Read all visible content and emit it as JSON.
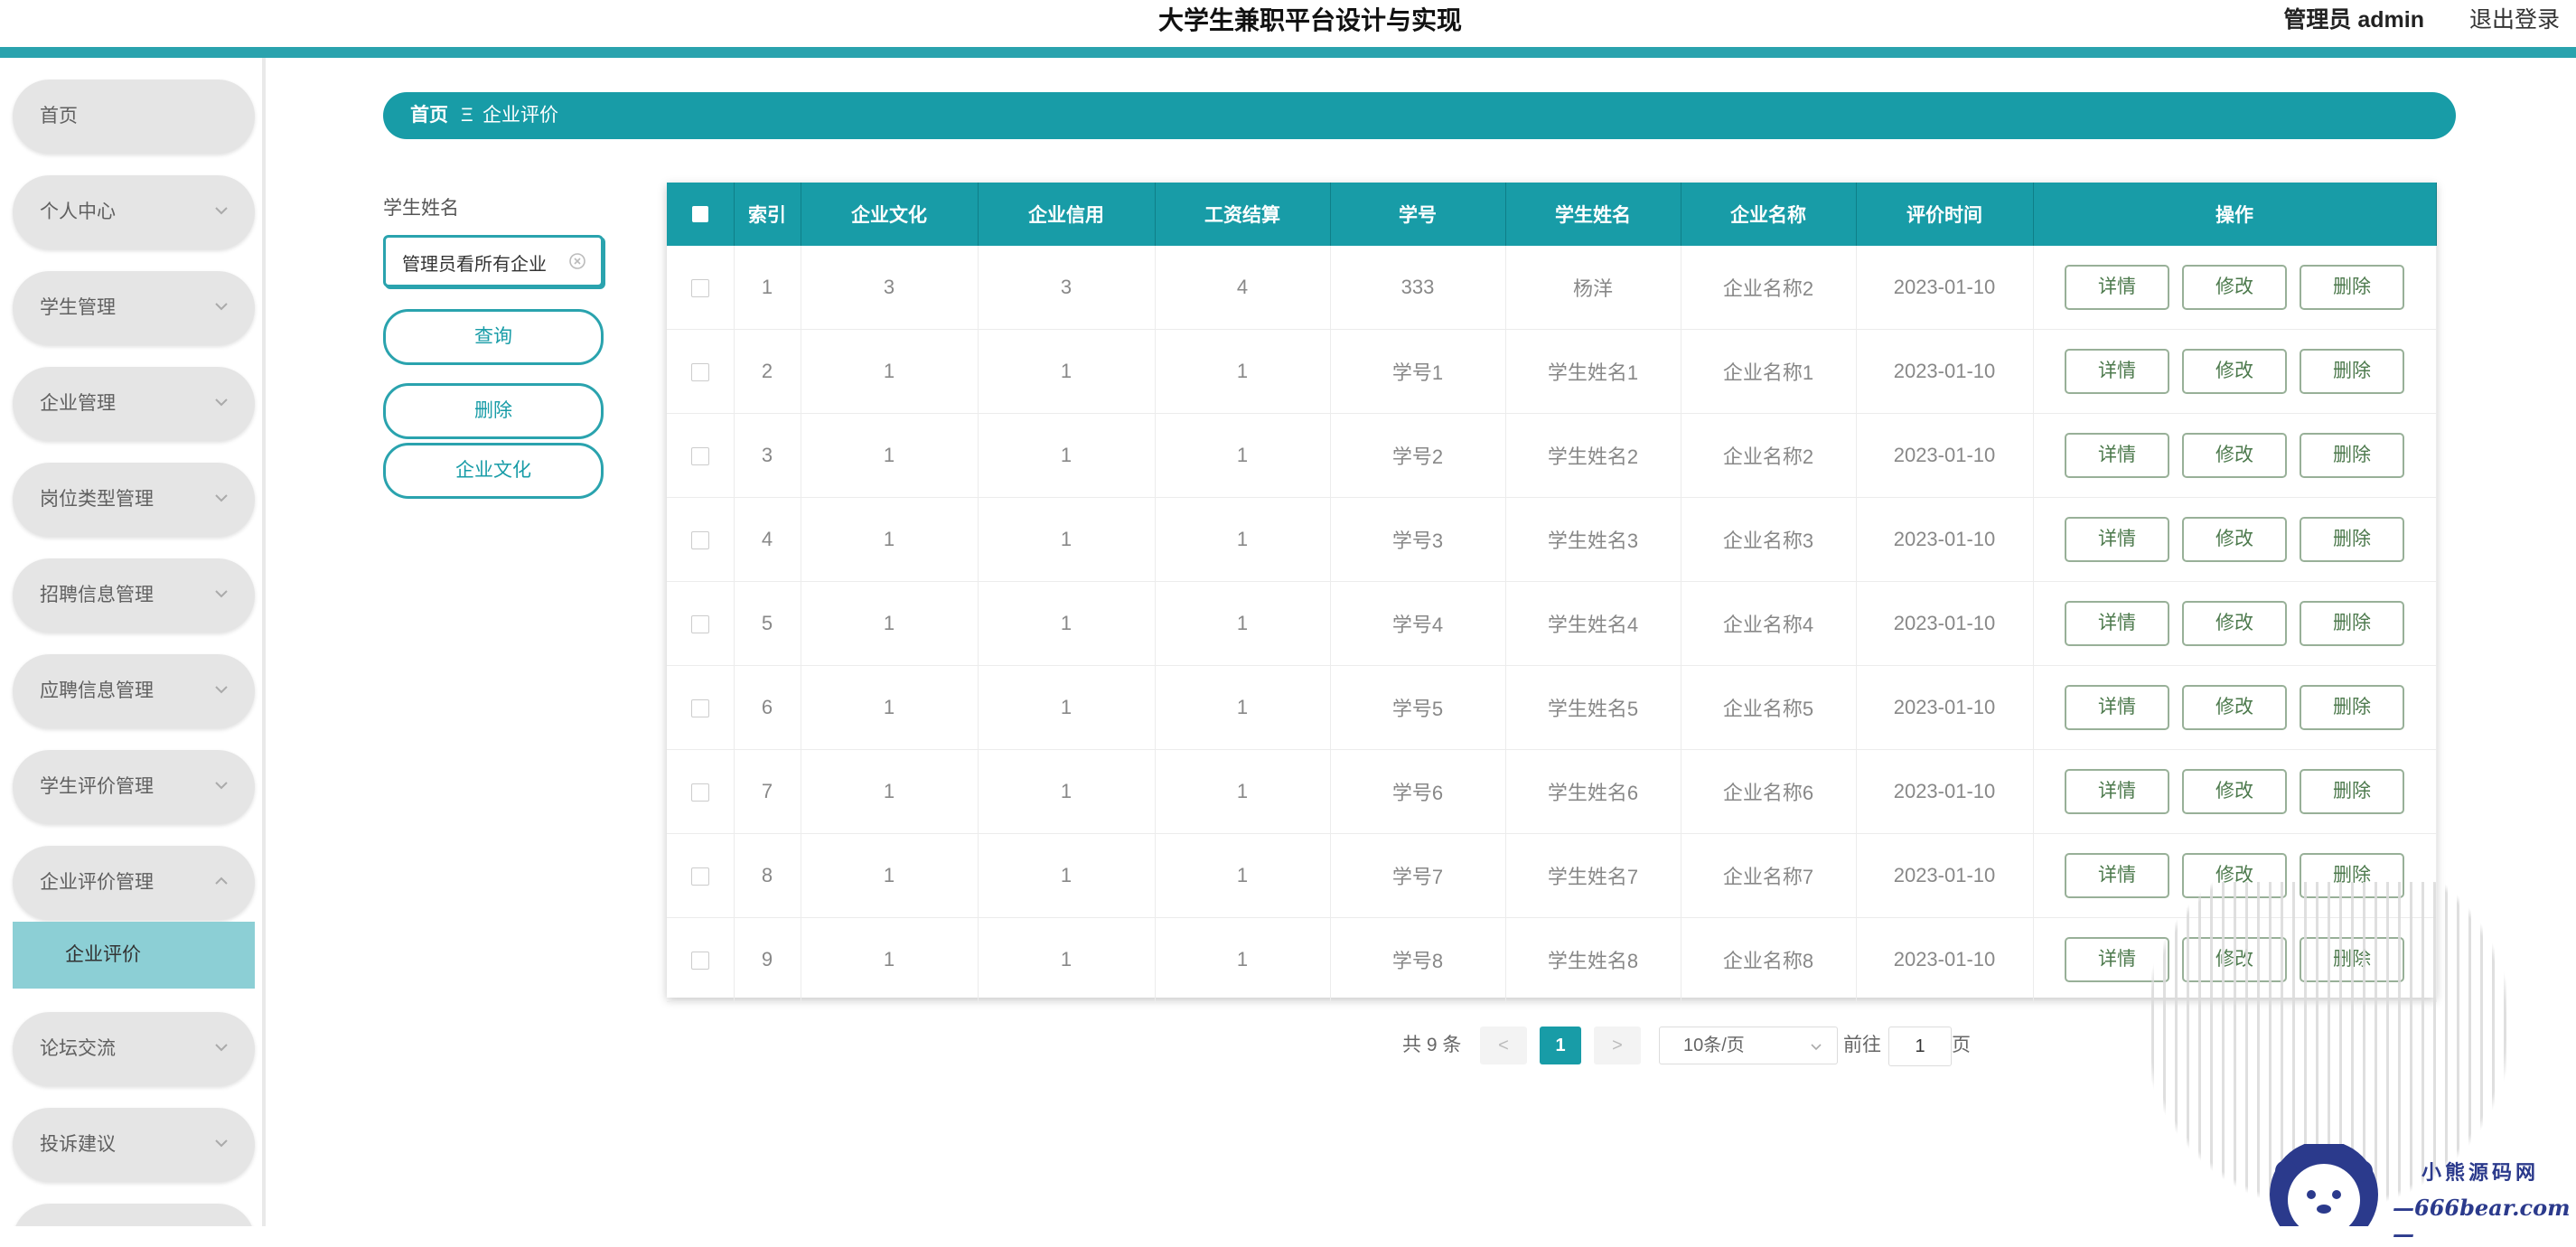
{
  "header": {
    "title": "大学生兼职平台设计与实现",
    "user": "管理员 admin",
    "logout": "退出登录"
  },
  "sidebar": {
    "items": [
      {
        "label": "首页",
        "chevron": "none"
      },
      {
        "label": "个人中心",
        "chevron": "down"
      },
      {
        "label": "学生管理",
        "chevron": "down"
      },
      {
        "label": "企业管理",
        "chevron": "down"
      },
      {
        "label": "岗位类型管理",
        "chevron": "down"
      },
      {
        "label": "招聘信息管理",
        "chevron": "down"
      },
      {
        "label": "应聘信息管理",
        "chevron": "down"
      },
      {
        "label": "学生评价管理",
        "chevron": "down"
      },
      {
        "label": "企业评价管理",
        "chevron": "up"
      },
      {
        "label": "论坛交流",
        "chevron": "down"
      },
      {
        "label": "投诉建议",
        "chevron": "down"
      }
    ],
    "sub_item": "企业评价"
  },
  "breadcrumb": {
    "home": "首页",
    "separator": "Ξ",
    "current": "企业评价"
  },
  "search": {
    "label": "学生姓名",
    "value": "管理员看所有企业",
    "query_button": "查询",
    "delete_button": "删除",
    "culture_button": "企业文化"
  },
  "table": {
    "headers": [
      "索引",
      "企业文化",
      "企业信用",
      "工资结算",
      "学号",
      "学生姓名",
      "企业名称",
      "评价时间",
      "操作"
    ],
    "rows": [
      [
        "1",
        "3",
        "3",
        "4",
        "333",
        "杨洋",
        "企业名称2",
        "2023-01-10"
      ],
      [
        "2",
        "1",
        "1",
        "1",
        "学号1",
        "学生姓名1",
        "企业名称1",
        "2023-01-10"
      ],
      [
        "3",
        "1",
        "1",
        "1",
        "学号2",
        "学生姓名2",
        "企业名称2",
        "2023-01-10"
      ],
      [
        "4",
        "1",
        "1",
        "1",
        "学号3",
        "学生姓名3",
        "企业名称3",
        "2023-01-10"
      ],
      [
        "5",
        "1",
        "1",
        "1",
        "学号4",
        "学生姓名4",
        "企业名称4",
        "2023-01-10"
      ],
      [
        "6",
        "1",
        "1",
        "1",
        "学号5",
        "学生姓名5",
        "企业名称5",
        "2023-01-10"
      ],
      [
        "7",
        "1",
        "1",
        "1",
        "学号6",
        "学生姓名6",
        "企业名称6",
        "2023-01-10"
      ],
      [
        "8",
        "1",
        "1",
        "1",
        "学号7",
        "学生姓名7",
        "企业名称7",
        "2023-01-10"
      ],
      [
        "9",
        "1",
        "1",
        "1",
        "学号8",
        "学生姓名8",
        "企业名称8",
        "2023-01-10"
      ]
    ],
    "actions": [
      "详情",
      "修改",
      "删除"
    ]
  },
  "pagination": {
    "total": "共 9 条",
    "prev": "<",
    "current_page": "1",
    "next": ">",
    "page_size": "10条/页",
    "goto_label": "前往",
    "goto_value": "1",
    "page_suffix": "页"
  },
  "watermark": {
    "name": "小熊源码网",
    "url": "—666bear.com—"
  },
  "colors": {
    "primary": "#189ca7",
    "stripe": "#2aa3ae",
    "sidebar_active": "#8ccfd5",
    "menu_bg": "#e5e5e5",
    "action_border": "#98b098"
  }
}
